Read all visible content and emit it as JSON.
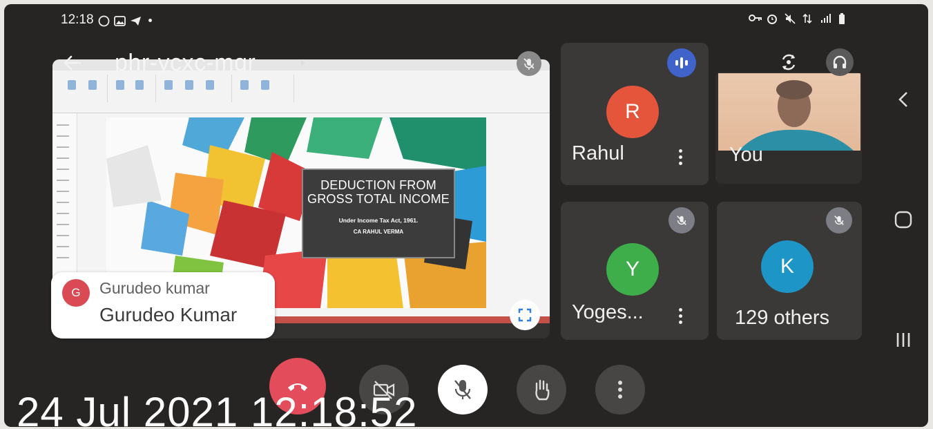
{
  "status_bar": {
    "time": "12:18",
    "left_icons": [
      "whatsapp-icon",
      "gallery-icon",
      "telegram-icon",
      "dot-icon"
    ],
    "right_icons": [
      "vpn-key-icon",
      "alarm-icon",
      "mute-icon",
      "data-icon",
      "signal-icon",
      "battery-icon"
    ]
  },
  "header": {
    "meeting_code": "phr-ycxc-mqr"
  },
  "presentation": {
    "slide_title": "DEDUCTION FROM GROSS TOTAL INCOME",
    "slide_subtitle": "Under Income Tax Act, 1961.",
    "slide_author": "CA RAHUL VERMA"
  },
  "chat_toast": {
    "avatar_letter": "G",
    "sender": "Gurudeo kumar",
    "message": "Gurudeo Kumar"
  },
  "participants": [
    {
      "initial": "R",
      "name": "Rahul",
      "color": "#e4553c"
    },
    {
      "name": "You"
    },
    {
      "initial": "Y",
      "name": "Yoges...",
      "color": "#3dae4a"
    },
    {
      "initial": "K",
      "name": "129 others",
      "color": "#1e95c7"
    }
  ],
  "controls": [
    "end-call",
    "video-off",
    "mic-off",
    "raise-hand",
    "more-options"
  ],
  "colors": {
    "end_call": "#e34c5a",
    "audio_indicator": "#3f63c9",
    "background": "#262524"
  },
  "timestamp": "24 Jul 2021 12:18:52"
}
